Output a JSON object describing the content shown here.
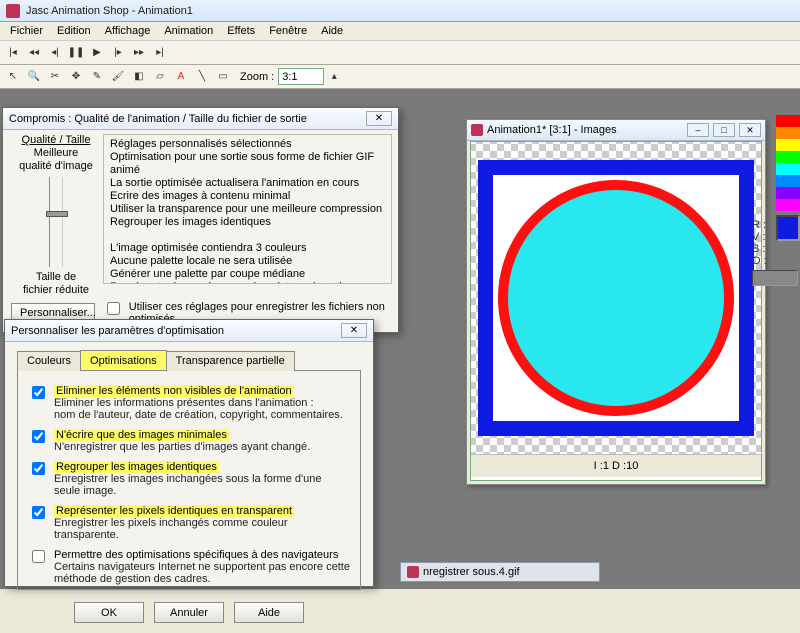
{
  "app": {
    "title": "Jasc Animation Shop - Animation1"
  },
  "menus": [
    "Fichier",
    "Edition",
    "Affichage",
    "Animation",
    "Effets",
    "Fenêtre",
    "Aide"
  ],
  "zoom": {
    "label": "Zoom :",
    "value": "3:1"
  },
  "canvas": {
    "title": "Animation1* [3:1] - Images",
    "info": "I :1   D :10"
  },
  "rgb": {
    "r": "R :",
    "v": "V :",
    "b": "B :",
    "o": "O :"
  },
  "taskbar_file": "nregistrer sous.4.gif",
  "dlg1": {
    "title": "Compromis : Qualité de l'animation / Taille du fichier de sortie",
    "slider_header": "Qualité / Taille",
    "slider_top": "Meilleure\nqualité d'image",
    "slider_bottom": "Taille de\nfichier réduite",
    "personnaliser": "Personnaliser...",
    "info_lines": [
      "Réglages personnalisés sélectionnés",
      "Optimisation pour une sortie sous forme de fichier GIF animé",
      "La sortie optimisée actualisera l'animation en cours",
      "Ecrire des images à contenu minimal",
      "Utiliser la transparence pour une meilleure compression",
      "Regrouper les images identiques",
      "",
      "L'image optimisée contiendra 3 couleurs",
      "Aucune palette locale ne sera utilisée",
      "Générer une palette par coupe médiane",
      "Représenter les couleurs sur la palette suivant la méthode de diffusion d'erreur."
    ],
    "save_unopt": "Utiliser ces réglages pour enregistrer les fichiers non optimisés"
  },
  "dlg2": {
    "title": "Personnaliser les paramètres d'optimisation",
    "tabs": {
      "colors": "Couleurs",
      "optim": "Optimisations",
      "trans": "Transparence partielle"
    },
    "opt1": {
      "label": "Eliminer les éléments non visibles de l'animation",
      "sub": "Eliminer les informations présentes dans l'animation :\nnom de l'auteur, date de création, copyright, commentaires."
    },
    "opt2": {
      "label": "N'écrire que des images minimales",
      "sub": "N'enregistrer que les parties d'images ayant changé."
    },
    "opt3": {
      "label": "Regrouper les images identiques",
      "sub": "Enregistrer les images inchangées sous la forme d'une seule image."
    },
    "opt4": {
      "label": "Représenter les pixels identiques en transparent",
      "sub": "Enregistrer les pixels inchangés comme couleur transparente."
    },
    "opt5": {
      "label": "Permettre des optimisations spécifiques à des navigateurs",
      "sub": "Certains navigateurs Internet ne supportent pas encore cette méthode de gestion des cadres."
    },
    "ok": "OK",
    "cancel": "Annuler",
    "help": "Aide"
  }
}
